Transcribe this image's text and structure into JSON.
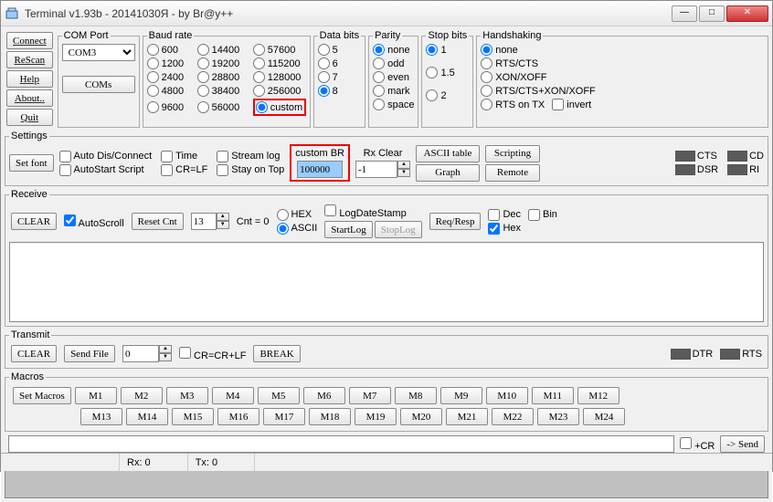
{
  "title": "Terminal v1.93b - 20141030Я - by Br@y++",
  "winbtns": {
    "min": "—",
    "max": "□",
    "close": "✕"
  },
  "top_buttons": {
    "connect": "Connect",
    "rescan": "ReScan",
    "help": "Help",
    "about": "About..",
    "quit": "Quit"
  },
  "comport": {
    "legend": "COM Port",
    "value": "COM3",
    "coms": "COMs"
  },
  "baud": {
    "legend": "Baud rate",
    "options": [
      "600",
      "1200",
      "2400",
      "4800",
      "9600",
      "14400",
      "19200",
      "28800",
      "38400",
      "56000",
      "57600",
      "115200",
      "128000",
      "256000",
      "custom"
    ],
    "selected": "custom"
  },
  "databits": {
    "legend": "Data bits",
    "options": [
      "5",
      "6",
      "7",
      "8"
    ],
    "selected": "8"
  },
  "parity": {
    "legend": "Parity",
    "options": [
      "none",
      "odd",
      "even",
      "mark",
      "space"
    ],
    "selected": "none"
  },
  "stopbits": {
    "legend": "Stop bits",
    "options": [
      "1",
      "1.5",
      "2"
    ],
    "selected": "1"
  },
  "handshake": {
    "legend": "Handshaking",
    "options": [
      "none",
      "RTS/CTS",
      "XON/XOFF",
      "RTS/CTS+XON/XOFF",
      "RTS on TX"
    ],
    "selected": "none",
    "invert": "invert"
  },
  "settings": {
    "legend": "Settings",
    "setfont": "Set font",
    "chk": {
      "autodis": "Auto Dis/Connect",
      "autostart": "AutoStart Script",
      "time": "Time",
      "crlf": "CR=LF",
      "streamlog": "Stream log",
      "stayontop": "Stay on Top"
    },
    "custombr_label": "custom BR",
    "custombr_value": "100000",
    "rxclear": "Rx Clear",
    "rxclear_val": "-1",
    "asciitable": "ASCII table",
    "graph": "Graph",
    "scripting": "Scripting",
    "remote": "Remote",
    "leds": {
      "cts": "CTS",
      "cd": "CD",
      "dsr": "DSR",
      "ri": "RI"
    }
  },
  "receive": {
    "legend": "Receive",
    "clear": "CLEAR",
    "autoscroll": "AutoScroll",
    "resetcnt": "Reset Cnt",
    "cntval": "13",
    "cntlabel": "Cnt =  0",
    "hex": "HEX",
    "ascii": "ASCII",
    "logdate": "LogDateStamp",
    "startlog": "StartLog",
    "stoplog": "StopLog",
    "reqresp": "Req/Resp",
    "dec": "Dec",
    "bin": "Bin",
    "hexchk": "Hex"
  },
  "transmit": {
    "legend": "Transmit",
    "clear": "CLEAR",
    "sendfile": "Send File",
    "spin": "0",
    "crcrlf": "CR=CR+LF",
    "break": "BREAK",
    "dtr": "DTR",
    "rts": "RTS"
  },
  "macros": {
    "legend": "Macros",
    "set": "Set Macros",
    "m": [
      "M1",
      "M2",
      "M3",
      "M4",
      "M5",
      "M6",
      "M7",
      "M8",
      "M9",
      "M10",
      "M11",
      "M12",
      "M13",
      "M14",
      "M15",
      "M16",
      "M17",
      "M18",
      "M19",
      "M20",
      "M21",
      "M22",
      "M23",
      "M24"
    ]
  },
  "sendline": {
    "cr": "+CR",
    "send": "-> Send"
  },
  "status": {
    "rx": "Rx: 0",
    "tx": "Tx: 0"
  }
}
